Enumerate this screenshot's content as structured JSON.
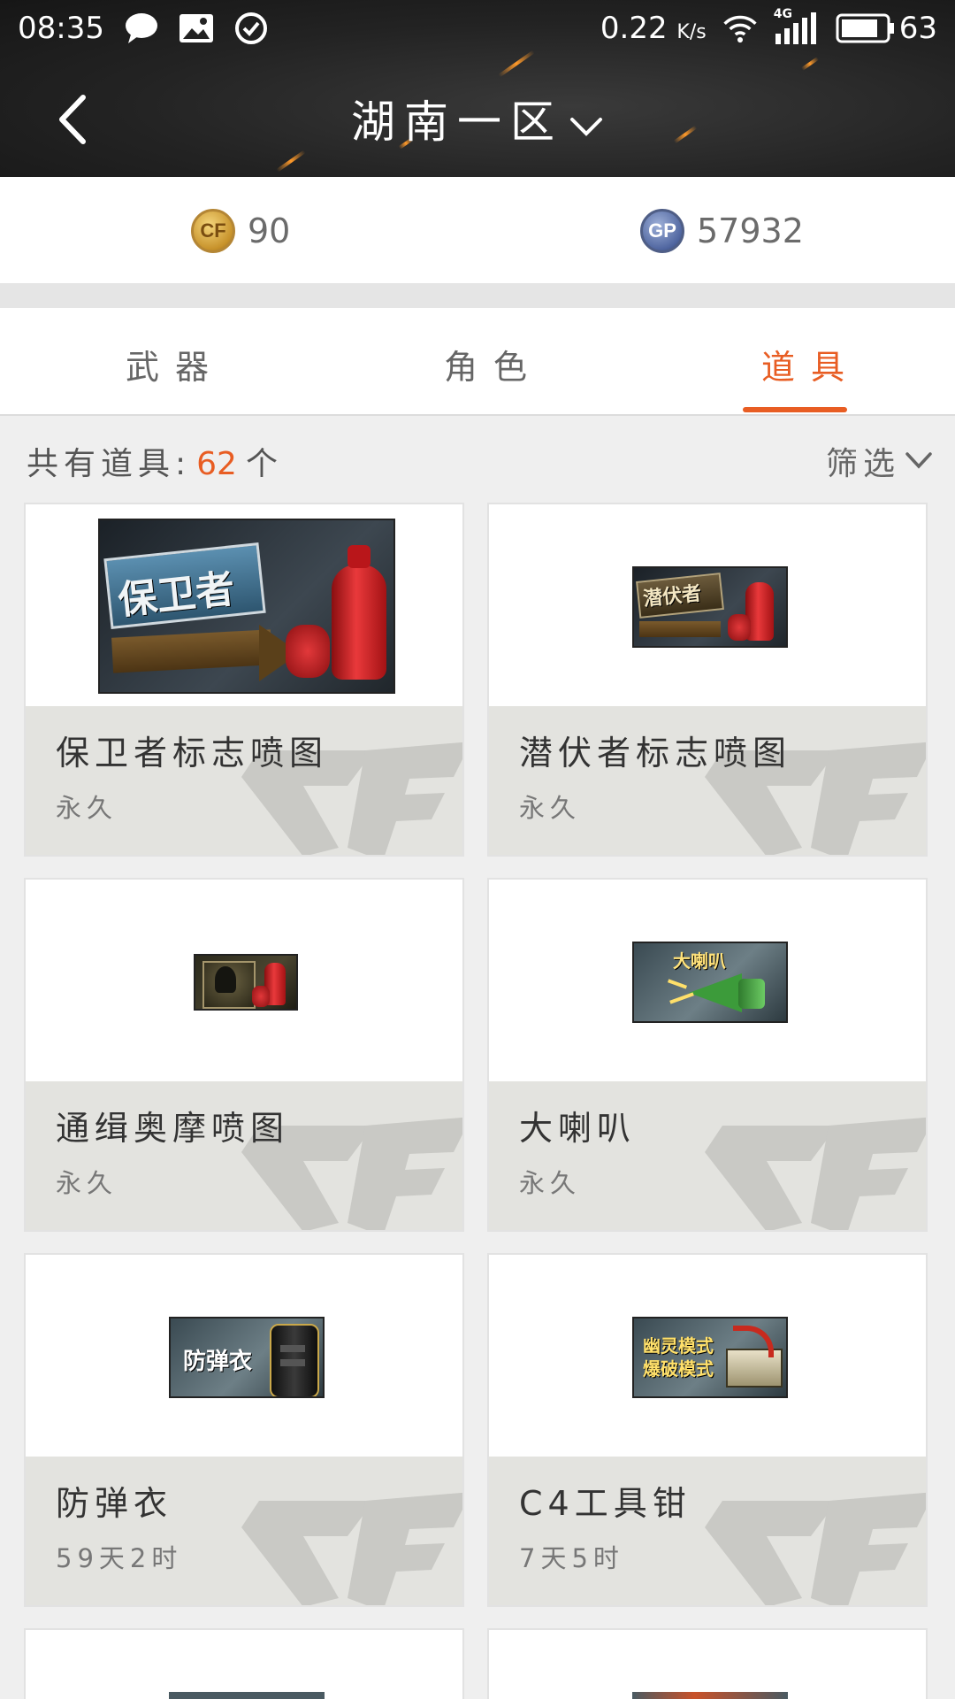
{
  "status_bar": {
    "time": "08:35",
    "net_speed": "0.22",
    "net_unit": "K/s",
    "network_type": "4G",
    "battery": "63"
  },
  "title_bar": {
    "title": "湖南一区"
  },
  "currency": {
    "cf_points": "90",
    "gp_points": "57932",
    "cf_badge": "CF",
    "gp_badge": "GP"
  },
  "tabs": [
    {
      "label": "武器",
      "active": false
    },
    {
      "label": "角色",
      "active": false
    },
    {
      "label": "道具",
      "active": true
    }
  ],
  "summary": {
    "prefix": "共有道具:",
    "count": "62",
    "unit": "个",
    "filter_label": "筛选"
  },
  "items": [
    {
      "name": "保卫者标志喷图",
      "duration": "永久",
      "thumb_text": "保卫者",
      "icon": "spray-paint-icon"
    },
    {
      "name": "潜伏者标志喷图",
      "duration": "永久",
      "thumb_text": "潜伏者",
      "icon": "spray-paint-icon"
    },
    {
      "name": "通缉奥摩喷图",
      "duration": "永久",
      "thumb_text": "",
      "icon": "spray-paint-icon"
    },
    {
      "name": "大喇叭",
      "duration": "永久",
      "thumb_text": "大喇叭",
      "icon": "megaphone-icon"
    },
    {
      "name": "防弹衣",
      "duration": "59天2时",
      "thumb_text": "防弹衣",
      "icon": "vest-icon"
    },
    {
      "name": "C4工具钳",
      "duration": "7天5时",
      "thumb_text": "幽灵模式 爆破模式",
      "icon": "c4-pliers-icon"
    }
  ],
  "colors": {
    "accent": "#e85d23",
    "header_bg": "#232323",
    "card_info_bg": "#e3e3df"
  }
}
